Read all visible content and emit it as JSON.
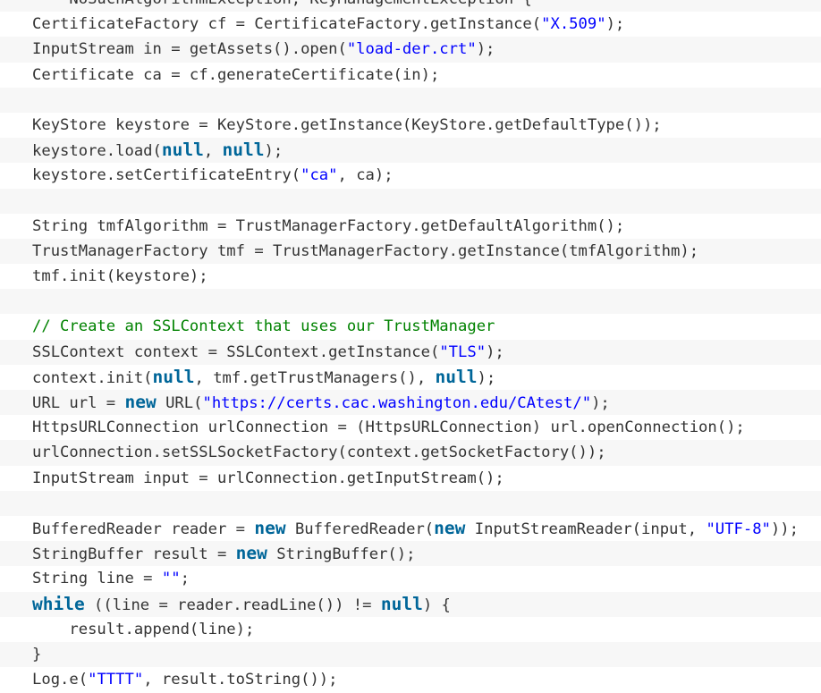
{
  "code": {
    "language": "Java",
    "lines": [
      [
        {
          "t": "code",
          "v": "    NoSuchAlgorithmException, KeyManagementException {"
        }
      ],
      [
        {
          "t": "code",
          "v": "CertificateFactory cf = CertificateFactory.getInstance("
        },
        {
          "t": "str",
          "v": "\"X.509\""
        },
        {
          "t": "code",
          "v": ");"
        }
      ],
      [
        {
          "t": "code",
          "v": "InputStream in = getAssets().open("
        },
        {
          "t": "str",
          "v": "\"load-der.crt\""
        },
        {
          "t": "code",
          "v": ");"
        }
      ],
      [
        {
          "t": "code",
          "v": "Certificate ca = cf.generateCertificate(in);"
        }
      ],
      [],
      [
        {
          "t": "code",
          "v": "KeyStore keystore = KeyStore.getInstance(KeyStore.getDefaultType());"
        }
      ],
      [
        {
          "t": "code",
          "v": "keystore.load("
        },
        {
          "t": "kw",
          "v": "null"
        },
        {
          "t": "code",
          "v": ", "
        },
        {
          "t": "kw",
          "v": "null"
        },
        {
          "t": "code",
          "v": ");"
        }
      ],
      [
        {
          "t": "code",
          "v": "keystore.setCertificateEntry("
        },
        {
          "t": "str",
          "v": "\"ca\""
        },
        {
          "t": "code",
          "v": ", ca);"
        }
      ],
      [],
      [
        {
          "t": "code",
          "v": "String tmfAlgorithm = TrustManagerFactory.getDefaultAlgorithm();"
        }
      ],
      [
        {
          "t": "code",
          "v": "TrustManagerFactory tmf = TrustManagerFactory.getInstance(tmfAlgorithm);"
        }
      ],
      [
        {
          "t": "code",
          "v": "tmf.init(keystore);"
        }
      ],
      [],
      [
        {
          "t": "cm",
          "v": "// Create an SSLContext that uses our TrustManager"
        }
      ],
      [
        {
          "t": "code",
          "v": "SSLContext context = SSLContext.getInstance("
        },
        {
          "t": "str",
          "v": "\"TLS\""
        },
        {
          "t": "code",
          "v": ");"
        }
      ],
      [
        {
          "t": "code",
          "v": "context.init("
        },
        {
          "t": "kw",
          "v": "null"
        },
        {
          "t": "code",
          "v": ", tmf.getTrustManagers(), "
        },
        {
          "t": "kw",
          "v": "null"
        },
        {
          "t": "code",
          "v": ");"
        }
      ],
      [
        {
          "t": "code",
          "v": "URL url = "
        },
        {
          "t": "kw",
          "v": "new"
        },
        {
          "t": "code",
          "v": " URL("
        },
        {
          "t": "str",
          "v": "\"https://certs.cac.washington.edu/CAtest/\""
        },
        {
          "t": "code",
          "v": ");"
        }
      ],
      [
        {
          "t": "code",
          "v": "HttpsURLConnection urlConnection = (HttpsURLConnection) url.openConnection();"
        }
      ],
      [
        {
          "t": "code",
          "v": "urlConnection.setSSLSocketFactory(context.getSocketFactory());"
        }
      ],
      [
        {
          "t": "code",
          "v": "InputStream input = urlConnection.getInputStream();"
        }
      ],
      [],
      [
        {
          "t": "code",
          "v": "BufferedReader reader = "
        },
        {
          "t": "kw",
          "v": "new"
        },
        {
          "t": "code",
          "v": " BufferedReader("
        },
        {
          "t": "kw",
          "v": "new"
        },
        {
          "t": "code",
          "v": " InputStreamReader(input, "
        },
        {
          "t": "str",
          "v": "\"UTF-8\""
        },
        {
          "t": "code",
          "v": "));"
        }
      ],
      [
        {
          "t": "code",
          "v": "StringBuffer result = "
        },
        {
          "t": "kw",
          "v": "new"
        },
        {
          "t": "code",
          "v": " StringBuffer();"
        }
      ],
      [
        {
          "t": "code",
          "v": "String line = "
        },
        {
          "t": "str",
          "v": "\"\""
        },
        {
          "t": "code",
          "v": ";"
        }
      ],
      [
        {
          "t": "kw",
          "v": "while"
        },
        {
          "t": "code",
          "v": " ((line = reader.readLine()) != "
        },
        {
          "t": "kw",
          "v": "null"
        },
        {
          "t": "code",
          "v": ") {"
        }
      ],
      [
        {
          "t": "code",
          "v": "    result.append(line);"
        }
      ],
      [
        {
          "t": "code",
          "v": "}"
        }
      ],
      [
        {
          "t": "code",
          "v": "Log.e("
        },
        {
          "t": "str",
          "v": "\"TTTT\""
        },
        {
          "t": "code",
          "v": ", result.toString());"
        }
      ]
    ]
  },
  "colors": {
    "keyword": "#006699",
    "string": "#0000ff",
    "comment": "#008200",
    "plain": "#333333",
    "stripe_odd": "#f7f7f7",
    "stripe_even": "#ffffff"
  }
}
